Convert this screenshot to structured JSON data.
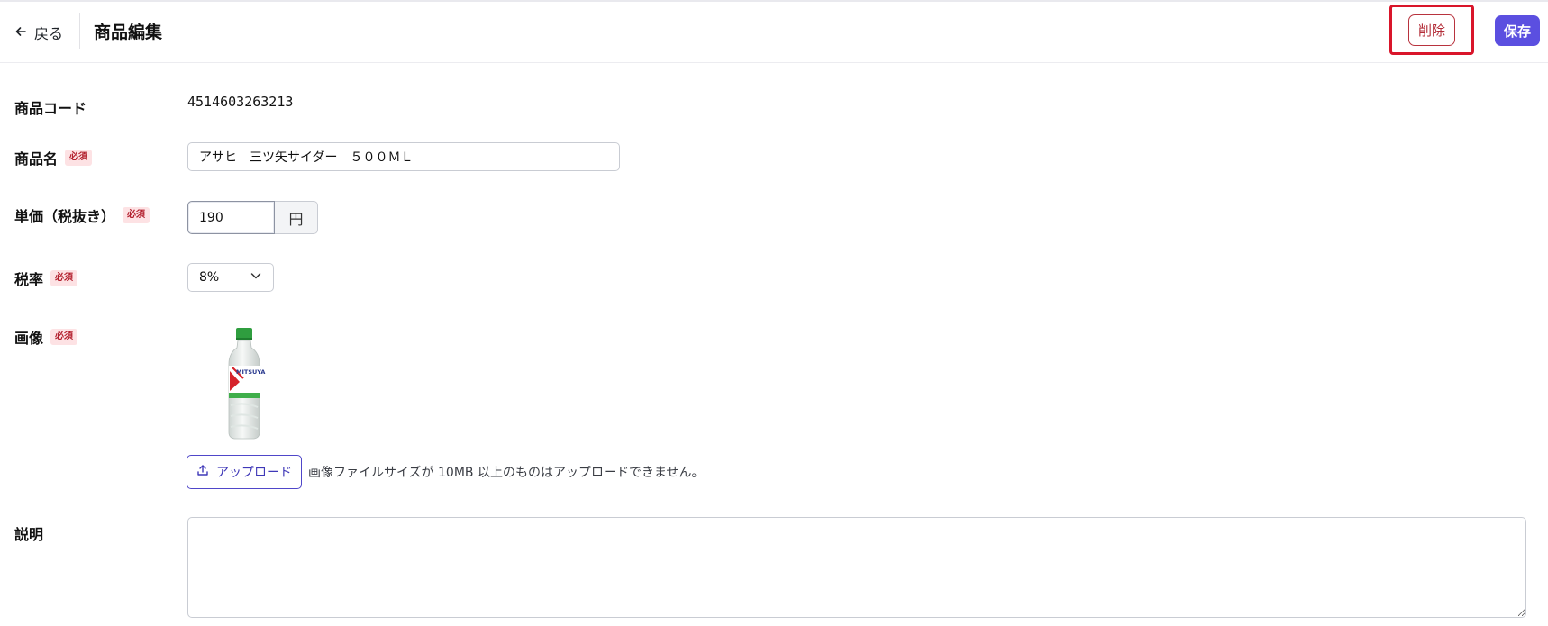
{
  "header": {
    "back_label": "戻る",
    "title": "商品編集",
    "delete_label": "削除",
    "save_label": "保存"
  },
  "required_badge": "必須",
  "form": {
    "code": {
      "label": "商品コード",
      "value": "4514603263213"
    },
    "name": {
      "label": "商品名",
      "value": "アサヒ　三ツ矢サイダー　５００ＭＬ"
    },
    "price": {
      "label": "単価（税抜き）",
      "value": "190",
      "unit": "円"
    },
    "tax": {
      "label": "税率",
      "value": "8%"
    },
    "image": {
      "label": "画像",
      "upload_label": "アップロード",
      "note": "画像ファイルサイズが 10MB 以上のものはアップロードできません。",
      "bottle_label": "MITSUYA CIDER"
    },
    "description": {
      "label": "説明",
      "value": ""
    }
  },
  "colors": {
    "accent": "#5b4fe0",
    "danger": "#b32d38",
    "highlight": "#d9152a"
  }
}
